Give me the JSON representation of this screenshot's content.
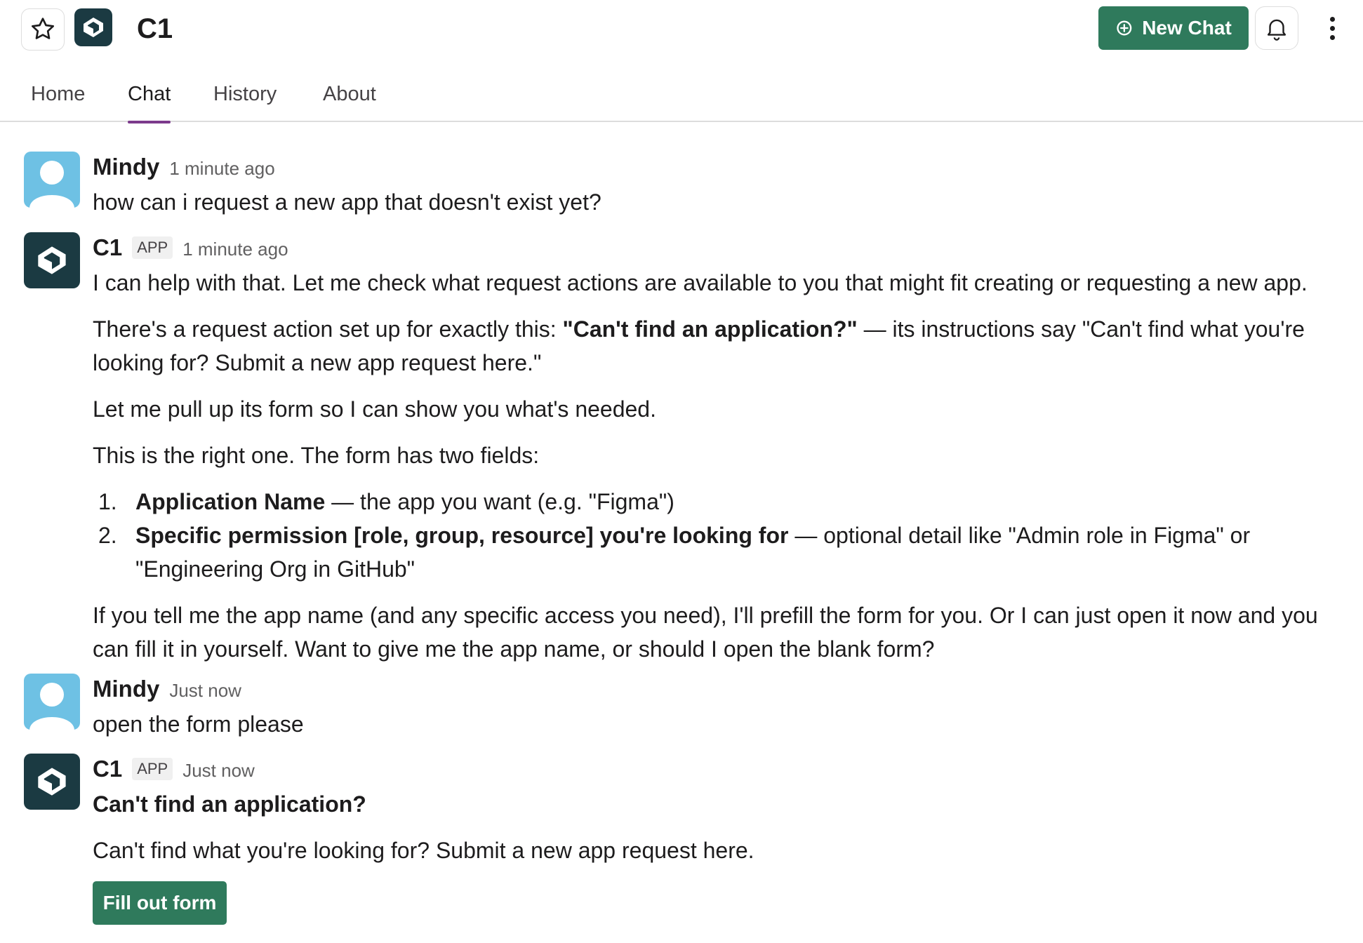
{
  "header": {
    "app_name": "C1",
    "new_chat_label": "New Chat"
  },
  "tabs": [
    {
      "label": "Home"
    },
    {
      "label": "Chat"
    },
    {
      "label": "History"
    },
    {
      "label": "About"
    }
  ],
  "active_tab": "Chat",
  "messages": [
    {
      "author": "Mindy",
      "time": "1 minute ago",
      "text": "how can i request a new app that doesn't exist yet?"
    },
    {
      "author": "C1",
      "badge": "APP",
      "time": "1 minute ago",
      "p1": "I can help with that. Let me check what request actions are available to you that might fit creating or requesting a new app.",
      "p2_pre": "There's a request action set up for exactly this: ",
      "p2_bold": "\"Can't find an application?\"",
      "p2_post": " — its instructions say \"Can't find what you're looking for? Submit a new app request here.\"",
      "p3": "Let me pull up its form so I can show you what's needed.",
      "p4": "This is the right one. The form has two fields:",
      "list": [
        {
          "num": "1.",
          "bold": "Application Name",
          "rest": " — the app you want (e.g. \"Figma\")"
        },
        {
          "num": "2.",
          "bold": "Specific permission [role, group, resource] you're looking for",
          "rest": " — optional detail like \"Admin role in Figma\" or \"Engineering Org in GitHub\""
        }
      ],
      "p5": "If you tell me the app name (and any specific access you need), I'll prefill the form for you. Or I can just open it now and you can fill it in yourself. Want to give me the app name, or should I open the blank form?"
    },
    {
      "author": "Mindy",
      "time": "Just now",
      "text": "open the form please"
    },
    {
      "author": "C1",
      "badge": "APP",
      "time": "Just now",
      "form_title": "Can't find an application?",
      "form_desc": "Can't find what you're looking for? Submit a new app request here.",
      "button_label": "Fill out form"
    }
  ],
  "colors": {
    "accent_green": "#2f7a5c",
    "tab_underline": "#7c3a8c",
    "bot_avatar": "#1b3a42",
    "user_avatar": "#6ec1e4"
  },
  "icons": [
    "star-icon",
    "c1-logo-icon",
    "new-chat-plus-icon",
    "bell-icon",
    "more-vertical-icon",
    "user-avatar-icon"
  ]
}
